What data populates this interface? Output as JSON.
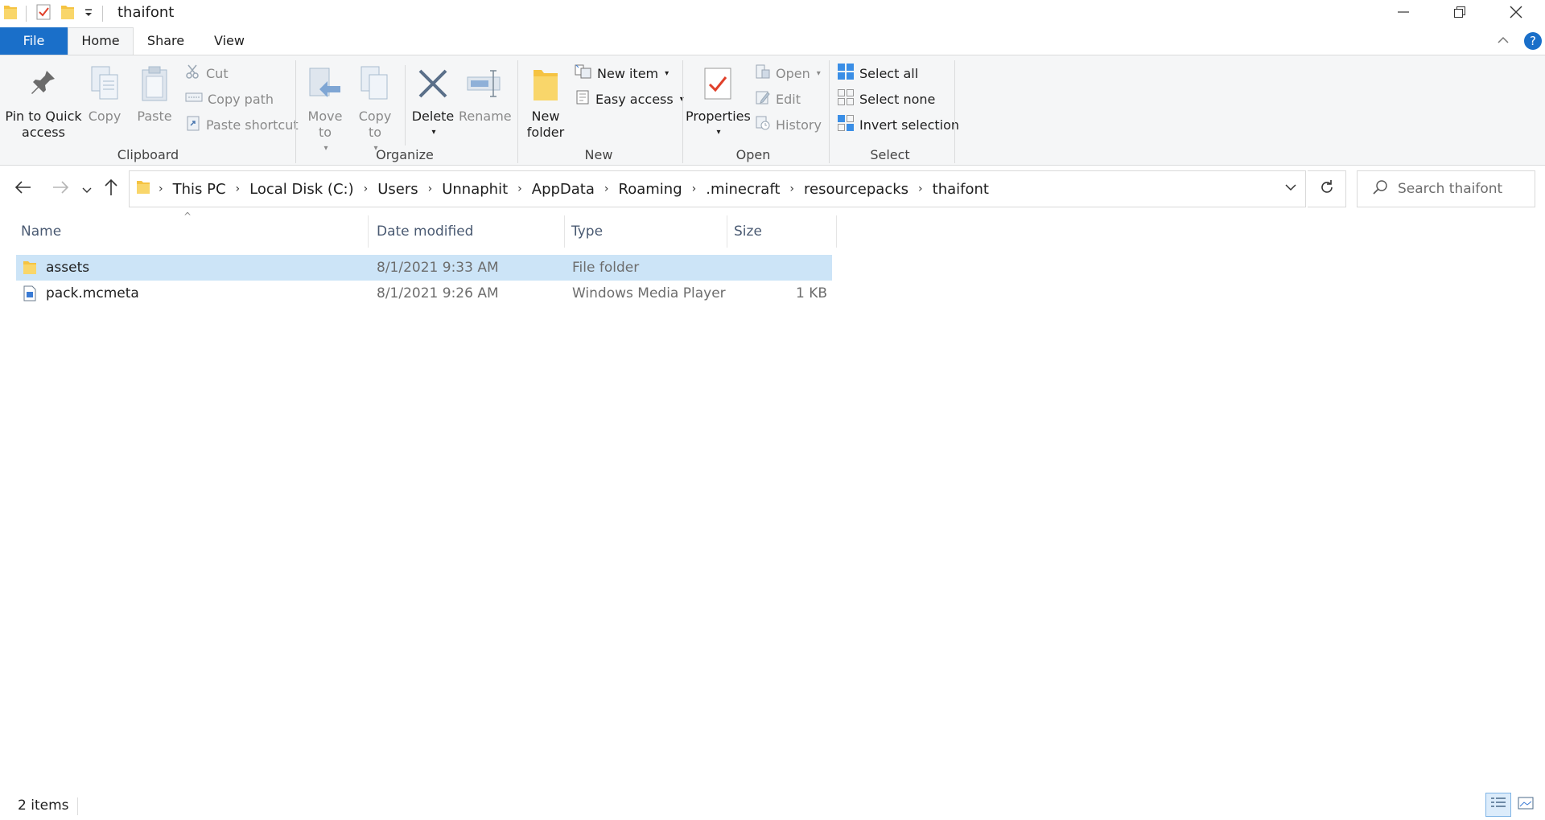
{
  "window": {
    "title": "thaifont",
    "controls": {
      "minimize": "minimize-icon",
      "restore": "restore-icon",
      "close": "close-icon"
    }
  },
  "ribbon_tabs": [
    {
      "label": "File"
    },
    {
      "label": "Home"
    },
    {
      "label": "Share"
    },
    {
      "label": "View"
    }
  ],
  "ribbon": {
    "clipboard": {
      "label": "Clipboard",
      "pin": "Pin to Quick access",
      "copy": "Copy",
      "paste": "Paste",
      "cut": "Cut",
      "copy_path": "Copy path",
      "paste_shortcut": "Paste shortcut"
    },
    "organize": {
      "label": "Organize",
      "move_to": "Move to",
      "copy_to": "Copy to",
      "delete": "Delete",
      "rename": "Rename"
    },
    "new": {
      "label": "New",
      "new_folder": "New folder",
      "new_item": "New item",
      "easy_access": "Easy access"
    },
    "open": {
      "label": "Open",
      "properties": "Properties",
      "open": "Open",
      "edit": "Edit",
      "history": "History"
    },
    "select": {
      "label": "Select",
      "select_all": "Select all",
      "select_none": "Select none",
      "invert_selection": "Invert selection"
    }
  },
  "address": {
    "crumbs": [
      "This PC",
      "Local Disk (C:)",
      "Users",
      "Unnaphit",
      "AppData",
      "Roaming",
      ".minecraft",
      "resourcepacks",
      "thaifont"
    ]
  },
  "search": {
    "placeholder": "Search thaifont"
  },
  "columns": {
    "name": "Name",
    "date_modified": "Date modified",
    "type": "Type",
    "size": "Size"
  },
  "files": [
    {
      "name": "assets",
      "date": "8/1/2021 9:33 AM",
      "type": "File folder",
      "size": "",
      "icon": "folder-icon",
      "selected": true
    },
    {
      "name": "pack.mcmeta",
      "date": "8/1/2021 9:26 AM",
      "type": "Windows Media Player",
      "size": "1 KB",
      "icon": "file-icon",
      "selected": false
    }
  ],
  "status": {
    "count": "2 items"
  },
  "colors": {
    "accent": "#1a6fc9",
    "selection": "#cce4f7",
    "ribbon_bg": "#f5f6f7"
  }
}
